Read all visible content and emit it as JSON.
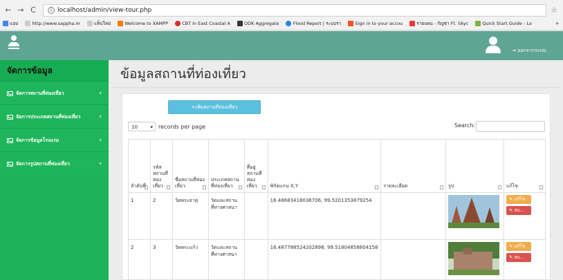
{
  "browser": {
    "url": "localhost/admin/view-tour.php",
    "bookmarks": [
      {
        "label": "แอป",
        "color": "#4285f4"
      },
      {
        "label": "http://www.sappha.m",
        "color": "#cccccc"
      },
      {
        "label": "แท็บใหม่",
        "color": "#cccccc"
      },
      {
        "label": "Welcome to XAMPP",
        "color": "#f57c00"
      },
      {
        "label": "CBT in East Coastal A",
        "color": "#d32f2f"
      },
      {
        "label": "ODK Aggregate",
        "color": "#333333"
      },
      {
        "label": "Flood Report | ระบบรา",
        "color": "#1e88e5"
      },
      {
        "label": "Sign in to your accou",
        "color": "#f4511e"
      },
      {
        "label": "รายแผน - กัญชา Ft. Skyc",
        "color": "#e53935"
      },
      {
        "label": "Quick Start Guide - Lo",
        "color": "#7cb342"
      }
    ],
    "more": "»"
  },
  "header": {
    "logout_label": "ออกจากระบบ",
    "color": "#5fa595"
  },
  "sidebar": {
    "title": "จัดการข้อมูล",
    "items": [
      {
        "label": "จัดการสถานที่ท่องเที่ยว"
      },
      {
        "label": "จัดการประเภทสถานที่ท่องเที่ยว"
      },
      {
        "label": "จัดการข้อมูลโรงแรม"
      },
      {
        "label": "จัดการรูปสถานที่ท่องเที่ยว"
      }
    ]
  },
  "main": {
    "page_title": "ข้อมูลสถานที่ท่องเที่ยว",
    "add_button": "+เพิ่มสถานที่ท่องเที่ยว",
    "page_length": "10",
    "records_label": "records per page",
    "search_label": "Search:",
    "search_value": "",
    "columns": [
      "ลำดับที่",
      "รหัสสถานที่ท่องเที่ยว",
      "ชื่อสถานที่ท่องเที่ยว",
      "ประเภทสถานที่ท่องเที่ยว",
      "ที่อยู่สถานที่ท่องเที่ยว",
      "พิกัดแกน X,Y",
      "รายละเอียด",
      "รูป",
      "แก้ไข"
    ],
    "rows": [
      {
        "no": "1",
        "code": "2",
        "name": "วัดพระธาตุ",
        "type": "วัดและสถานที่ทางศาสนา",
        "address": "",
        "coords": "16.48683418036706, 99.5201353879254",
        "detail": "",
        "image": "temple-ruins-photo",
        "edit": "แก้ไข",
        "del": "ลบ..."
      },
      {
        "no": "2",
        "code": "3",
        "name": "วัดพระแก้ว",
        "type": "วัดและสถานที่ทางศาสนา",
        "address": "",
        "coords": "16.487788524202898, 99.51804858804158",
        "detail": "",
        "image": "temple-ruins-photo",
        "edit": "แก้ไข",
        "del": "ลบ..."
      }
    ]
  }
}
